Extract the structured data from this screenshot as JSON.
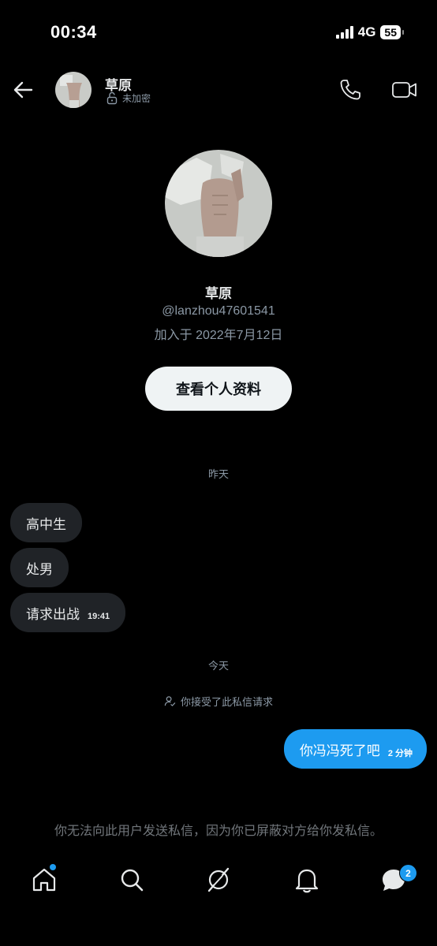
{
  "status_bar": {
    "time": "00:34",
    "network": "4G",
    "battery": "55"
  },
  "header": {
    "name": "草原",
    "encryption": "未加密"
  },
  "profile": {
    "name": "草原",
    "handle": "@lanzhou47601541",
    "joined": "加入于 2022年7月12日",
    "view_button": "查看个人资料"
  },
  "conversation": {
    "yesterday_label": "昨天",
    "incoming": [
      {
        "text": "高中生"
      },
      {
        "text": "处男"
      },
      {
        "text": "请求出战",
        "time": "19:41"
      }
    ],
    "today_label": "今天",
    "accepted_note": "你接受了此私信请求",
    "outgoing": [
      {
        "text": "你冯冯死了吧",
        "time": "2 分钟"
      }
    ]
  },
  "blocked_notice": "你无法向此用户发送私信，因为你已屏蔽对方给你发私信。",
  "nav": {
    "items": [
      "home-icon",
      "search-icon",
      "grok-icon",
      "bell-icon",
      "messages-icon"
    ],
    "messages_badge": "2"
  },
  "colors": {
    "accent": "#1d9bf0",
    "bubble_in": "#202327",
    "background": "#000000"
  }
}
